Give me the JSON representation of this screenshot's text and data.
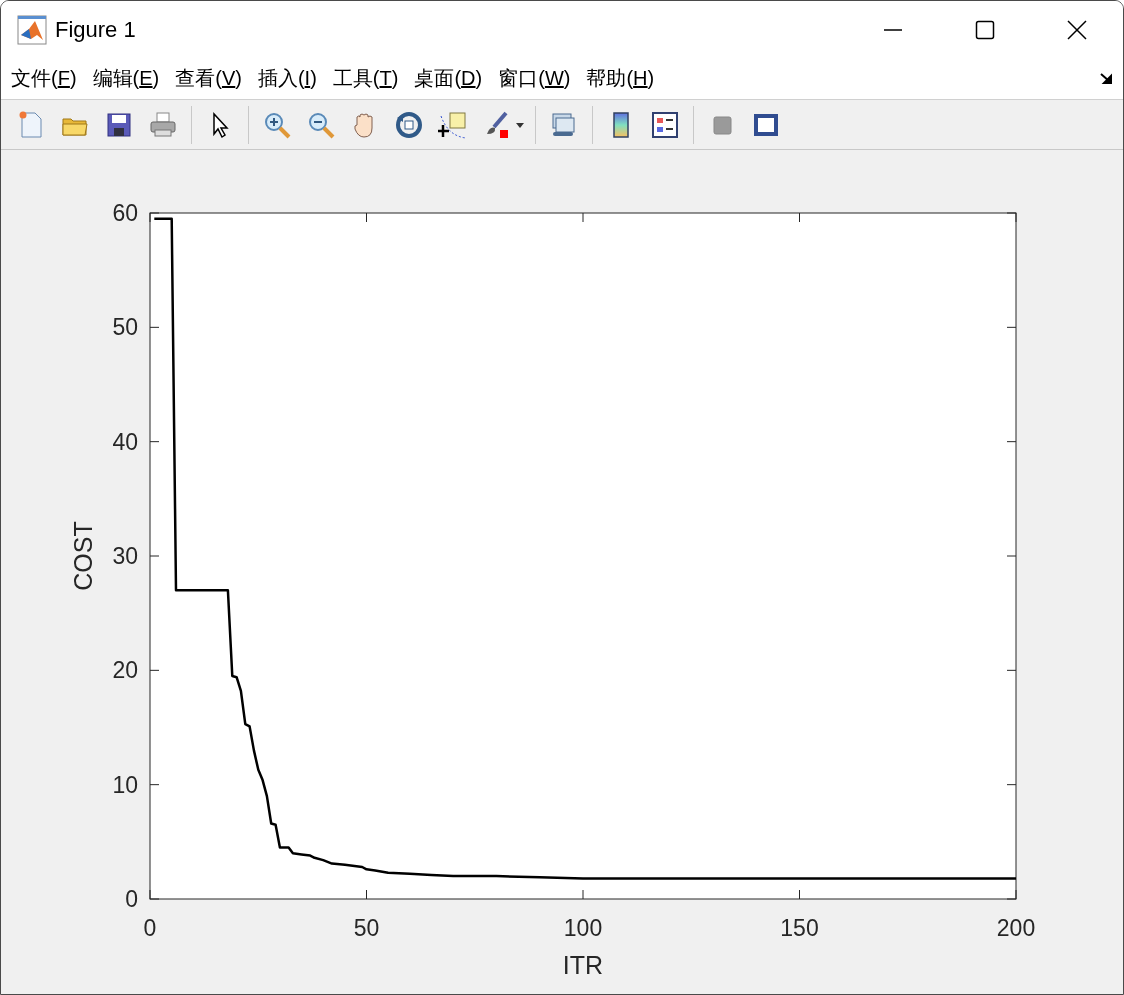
{
  "window": {
    "title": "Figure 1"
  },
  "menu": [
    {
      "text": "文件(",
      "access_key": "F",
      "end": ")"
    },
    {
      "text": "编辑(",
      "access_key": "E",
      "end": ")"
    },
    {
      "text": "查看(",
      "access_key": "V",
      "end": ")"
    },
    {
      "text": "插入(",
      "access_key": "I",
      "end": ")"
    },
    {
      "text": "工具(",
      "access_key": "T",
      "end": ")"
    },
    {
      "text": "桌面(",
      "access_key": "D",
      "end": ")"
    },
    {
      "text": "窗口(",
      "access_key": "W",
      "end": ")"
    },
    {
      "text": "帮助(",
      "access_key": "H",
      "end": ")"
    }
  ],
  "figure": {
    "chart_data": {
      "type": "line",
      "xlabel": "ITR",
      "ylabel": "COST",
      "x": [
        1,
        5,
        6,
        18,
        19,
        20,
        21,
        22,
        23,
        24,
        25,
        26,
        27,
        28,
        29,
        30,
        32,
        33,
        35,
        37,
        38,
        40,
        42,
        45,
        49,
        50,
        52,
        55,
        60,
        65,
        70,
        80,
        90,
        100,
        120,
        150,
        200
      ],
      "series": [
        {
          "color": "#000000",
          "values": [
            59.5,
            59.5,
            27,
            27,
            19.5,
            19.4,
            18.2,
            15.3,
            15.1,
            13,
            11.3,
            10.4,
            9,
            6.6,
            6.5,
            4.5,
            4.5,
            4,
            3.9,
            3.8,
            3.6,
            3.4,
            3.1,
            3.0,
            2.8,
            2.6,
            2.5,
            2.3,
            2.2,
            2.1,
            2.0,
            2.0,
            1.9,
            1.8,
            1.8,
            1.8,
            1.8
          ]
        }
      ],
      "xlim": [
        0,
        200
      ],
      "ylim": [
        0,
        60
      ],
      "xticks": [
        0,
        50,
        100,
        150,
        200
      ],
      "yticks": [
        0,
        10,
        20,
        30,
        40,
        50,
        60
      ]
    }
  }
}
